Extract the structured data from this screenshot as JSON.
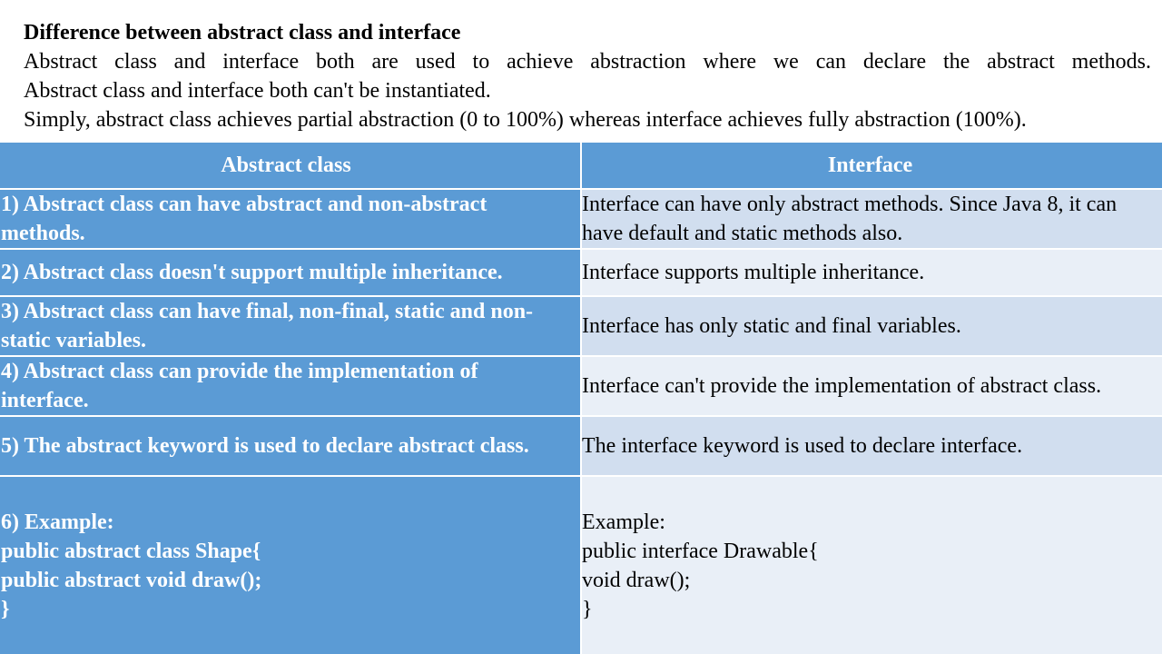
{
  "intro": {
    "heading": "Difference between abstract class and interface",
    "line1": "Abstract class and interface both are used to achieve abstraction where we can declare the abstract methods.",
    "line2": "Abstract class and interface both can't be instantiated.",
    "line3": "Simply, abstract class achieves partial abstraction (0 to 100%) whereas interface achieves fully abstraction (100%)."
  },
  "table": {
    "headers": {
      "left": "Abstract class",
      "right": "Interface"
    },
    "rows": [
      {
        "left": "1) Abstract class can have abstract and non-abstract methods.",
        "right": "Interface can have only abstract methods. Since Java 8, it can have default and static methods also."
      },
      {
        "left": "2) Abstract class doesn't support multiple inheritance.",
        "right": "Interface supports multiple inheritance."
      },
      {
        "left": "3) Abstract class can have final, non-final, static and non-static variables.",
        "right": "Interface has only static and final variables."
      },
      {
        "left": "4) Abstract class can provide the implementation of interface.",
        "right": "Interface can't provide the implementation of abstract class."
      },
      {
        "left": "5) The abstract keyword is used to declare abstract class.",
        "right": "The interface keyword is used to declare interface."
      },
      {
        "left": "6) Example:\npublic abstract class Shape{\npublic abstract void draw();\n}",
        "right": "Example:\npublic interface Drawable{\nvoid draw();\n}"
      }
    ]
  }
}
